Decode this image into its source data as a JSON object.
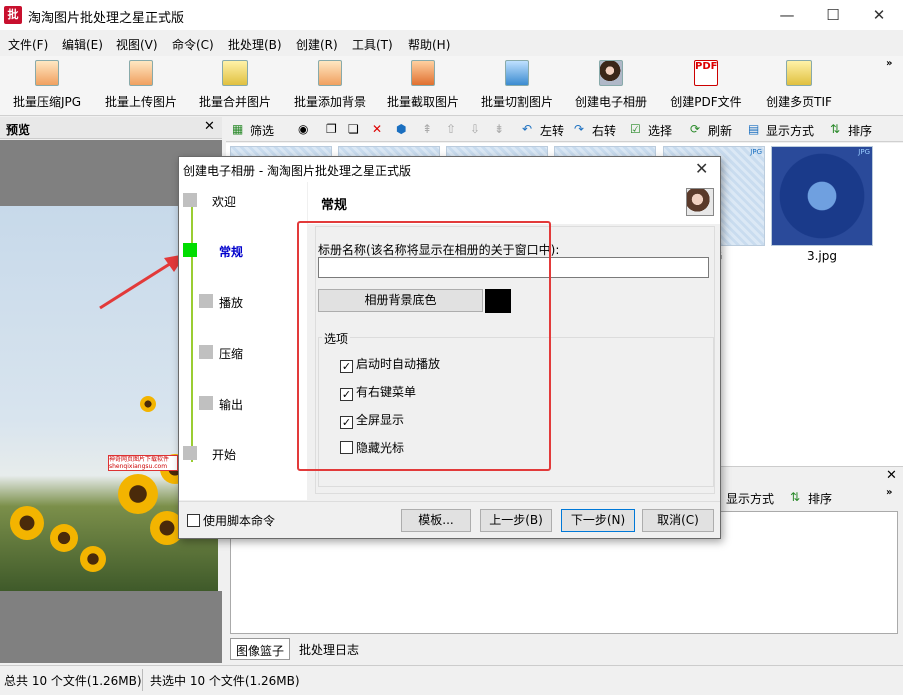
{
  "window": {
    "title": "淘淘图片批处理之星正式版",
    "logo_text": "批",
    "controls": {
      "minimize": "—",
      "maximize": "☐",
      "close": "✕"
    }
  },
  "menu": [
    "文件(F)",
    "编辑(E)",
    "视图(V)",
    "命令(C)",
    "批处理(B)",
    "创建(R)",
    "工具(T)",
    "帮助(H)"
  ],
  "toolbar": {
    "items": [
      "批量压缩JPG",
      "批量上传图片",
      "批量合并图片",
      "批量添加背景",
      "批量截取图片",
      "批量切割图片",
      "创建电子相册",
      "创建PDF文件",
      "创建多页TIF"
    ],
    "pdf_badge": "PDF",
    "more": "»"
  },
  "preview": {
    "title": "预览",
    "close": "✕",
    "watermark": "神奇网页图片下载软件 shenqixiangsu.com"
  },
  "file_toolbar": {
    "filter": "筛选",
    "rotate_left": "左转",
    "rotate_right": "右转",
    "select": "选择",
    "refresh": "刷新",
    "view_mode": "显示方式",
    "sort": "排序"
  },
  "thumbnails": {
    "visible_labels": [
      "PG",
      "3.jpg"
    ],
    "badge": "JPG"
  },
  "lower_panel": {
    "close": "✕",
    "view_mode": "显示方式",
    "sort": "排序",
    "more": "»"
  },
  "bottom_tabs": [
    "图像篮子",
    "批处理日志"
  ],
  "status": {
    "total": "总共 10 个文件(1.26MB)",
    "selected": "共选中 10 个文件(1.26MB)"
  },
  "dialog": {
    "title": "创建电子相册 - 淘淘图片批处理之星正式版",
    "close": "✕",
    "steps": [
      {
        "label": "欢迎",
        "active": false
      },
      {
        "label": "常规",
        "active": true
      },
      {
        "label": "播放",
        "active": false
      },
      {
        "label": "压缩",
        "active": false
      },
      {
        "label": "输出",
        "active": false
      },
      {
        "label": "开始",
        "active": false
      }
    ],
    "page_title": "常规",
    "album_name_label": "标册名称(该名称将显示在相册的关于窗口中):",
    "album_name_value": "",
    "bg_color_button": "相册背景底色",
    "bg_color": "#000000",
    "options_legend": "选项",
    "options": [
      {
        "label": "启动时自动播放",
        "checked": true
      },
      {
        "label": "有右键菜单",
        "checked": true
      },
      {
        "label": "全屏显示",
        "checked": true
      },
      {
        "label": "隐藏光标",
        "checked": false
      }
    ],
    "use_script": {
      "label": "使用脚本命令",
      "checked": false
    },
    "buttons": {
      "template": "模板...",
      "prev": "上一步(B)",
      "next": "下一步(N)",
      "cancel": "取消(C)"
    },
    "check_mark": "✓"
  },
  "colors": {
    "highlight": "#e23a3a",
    "active_step": "#00dd00",
    "step_line": "#9acd32"
  }
}
